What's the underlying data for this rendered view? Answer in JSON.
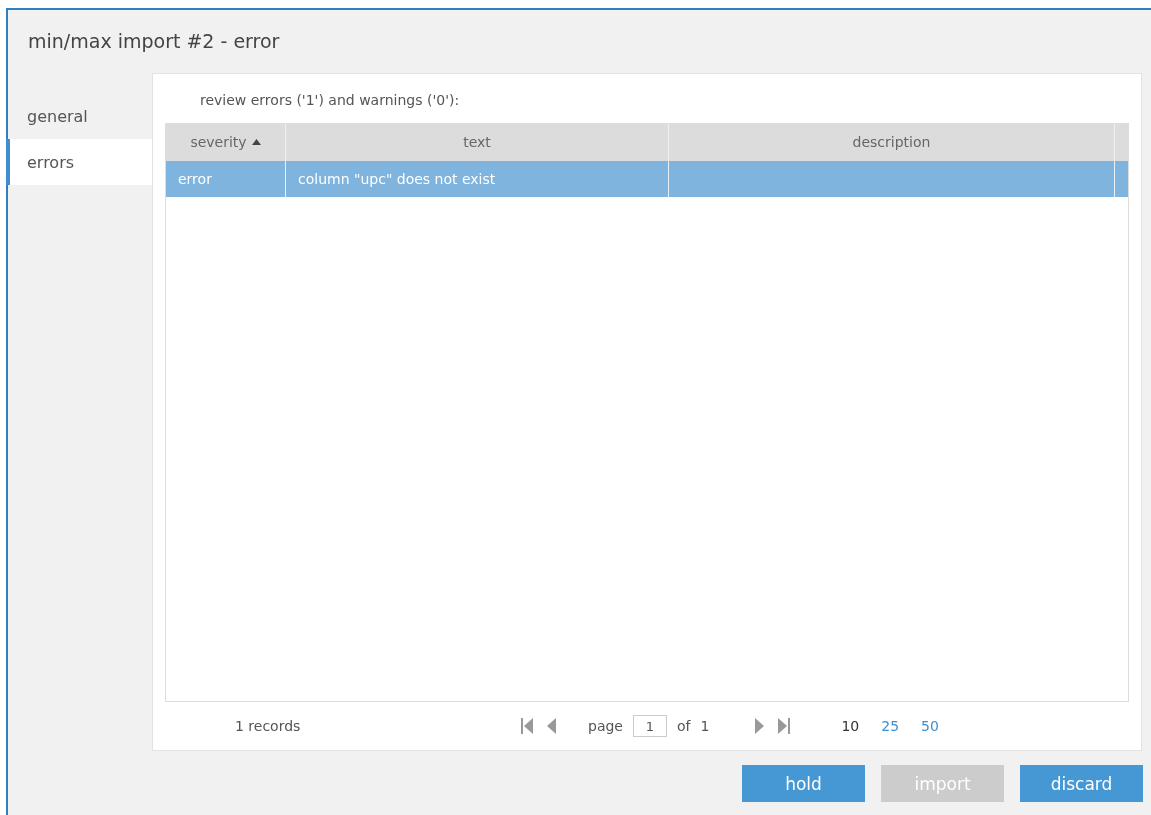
{
  "window": {
    "title": "min/max import #2 -  error"
  },
  "sidebar": {
    "items": [
      {
        "label": "general",
        "selected": false
      },
      {
        "label": "errors",
        "selected": true
      }
    ]
  },
  "summary": "review errors ('1') and warnings ('0'):",
  "table": {
    "columns": [
      {
        "label": "severity",
        "sorted": true
      },
      {
        "label": "text",
        "sorted": false
      },
      {
        "label": "description",
        "sorted": false
      }
    ],
    "rows": [
      {
        "cells": [
          "error",
          "column \"upc\" does not exist",
          ""
        ],
        "selected": true
      }
    ]
  },
  "pager": {
    "records": "1 records",
    "page_label": "page",
    "page": "1",
    "of_label": "of",
    "total": "1",
    "sizes": [
      {
        "label": "10",
        "selected": true
      },
      {
        "label": "25",
        "selected": false
      },
      {
        "label": "50",
        "selected": false
      }
    ]
  },
  "buttons": [
    {
      "label": "hold",
      "disabled": false
    },
    {
      "label": "import",
      "disabled": true
    },
    {
      "label": "discard",
      "disabled": false
    }
  ]
}
